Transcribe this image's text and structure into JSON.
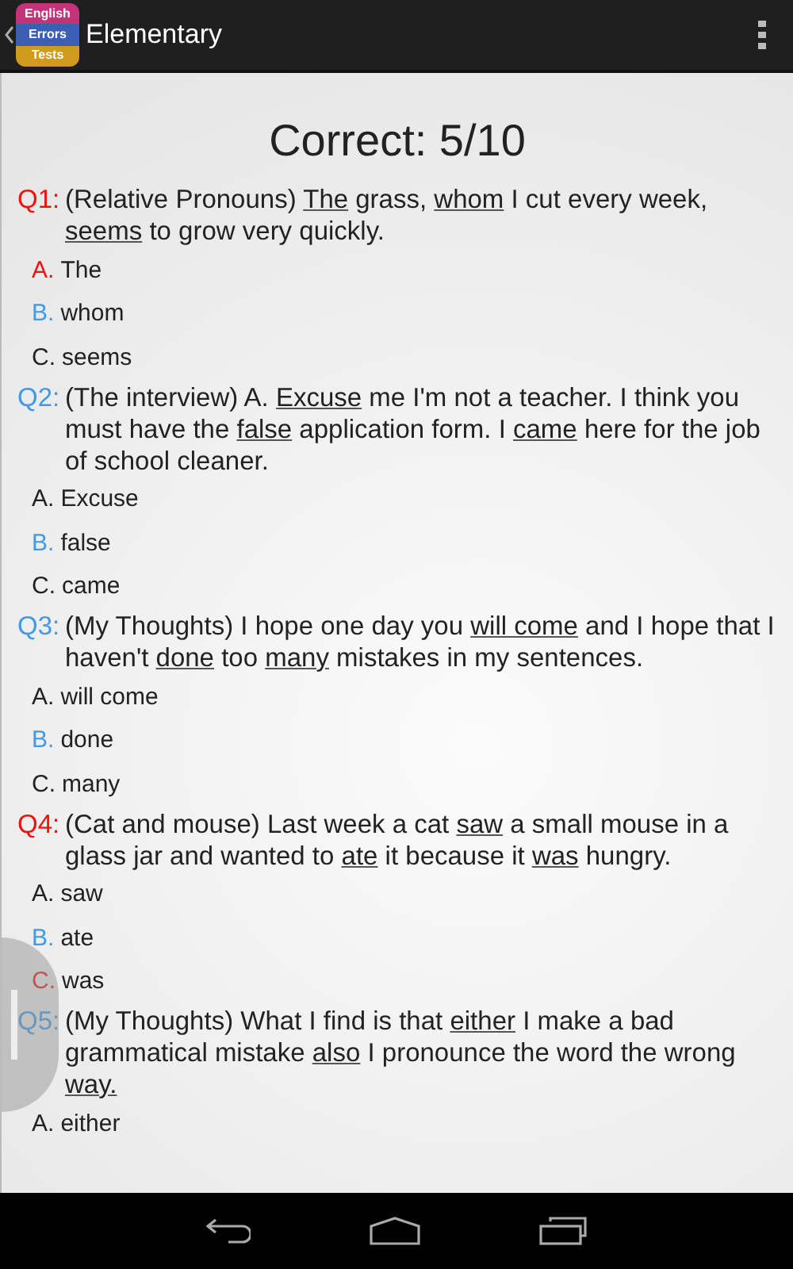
{
  "app_bar": {
    "logo_lines": [
      {
        "text": "English",
        "color": "#c2337a"
      },
      {
        "text": "Errors",
        "color": "#3b5fb5"
      },
      {
        "text": "Tests",
        "color": "#d19a1c"
      }
    ],
    "title": "Elementary"
  },
  "score": "Correct: 5/10",
  "questions": [
    {
      "label": "Q1:",
      "correct": false,
      "segments": [
        {
          "text": "(Relative Pronouns) ",
          "underlined": false
        },
        {
          "text": "The",
          "underlined": true
        },
        {
          "text": " grass, ",
          "underlined": false
        },
        {
          "text": "whom",
          "underlined": true
        },
        {
          "text": " I cut every week, ",
          "underlined": false
        },
        {
          "text": "seems",
          "underlined": true
        },
        {
          "text": " to grow very quickly.",
          "underlined": false
        }
      ],
      "options": [
        {
          "kind": "mistake",
          "letter": "A.",
          "text": "The"
        },
        {
          "kind": "answer",
          "letter": "B.",
          "text": "whom"
        },
        {
          "kind": "plain",
          "letter": "C.",
          "text": "seems"
        }
      ]
    },
    {
      "label": "Q2:",
      "correct": true,
      "segments": [
        {
          "text": "(The interview) A. ",
          "underlined": false
        },
        {
          "text": "Excuse",
          "underlined": true
        },
        {
          "text": " me I'm not a teacher. I think you must have the ",
          "underlined": false
        },
        {
          "text": "false",
          "underlined": true
        },
        {
          "text": " application form. I ",
          "underlined": false
        },
        {
          "text": "came",
          "underlined": true
        },
        {
          "text": " here for the job of school cleaner.",
          "underlined": false
        }
      ],
      "options": [
        {
          "kind": "plain",
          "letter": "A.",
          "text": "Excuse"
        },
        {
          "kind": "answer",
          "letter": "B.",
          "text": "false"
        },
        {
          "kind": "plain",
          "letter": "C.",
          "text": "came"
        }
      ]
    },
    {
      "label": "Q3:",
      "correct": true,
      "segments": [
        {
          "text": "(My Thoughts) I hope one day you ",
          "underlined": false
        },
        {
          "text": "will come",
          "underlined": true
        },
        {
          "text": " and I hope that I haven't ",
          "underlined": false
        },
        {
          "text": "done",
          "underlined": true
        },
        {
          "text": " too ",
          "underlined": false
        },
        {
          "text": "many",
          "underlined": true
        },
        {
          "text": " mistakes in my sentences.",
          "underlined": false
        }
      ],
      "options": [
        {
          "kind": "plain",
          "letter": "A.",
          "text": "will come"
        },
        {
          "kind": "answer",
          "letter": "B.",
          "text": "done"
        },
        {
          "kind": "plain",
          "letter": "C.",
          "text": "many"
        }
      ]
    },
    {
      "label": "Q4:",
      "correct": false,
      "segments": [
        {
          "text": "(Cat and mouse) Last week a cat ",
          "underlined": false
        },
        {
          "text": "saw",
          "underlined": true
        },
        {
          "text": " a small mouse in a glass jar and wanted to ",
          "underlined": false
        },
        {
          "text": "ate",
          "underlined": true
        },
        {
          "text": " it because it ",
          "underlined": false
        },
        {
          "text": "was",
          "underlined": true
        },
        {
          "text": " hungry.",
          "underlined": false
        }
      ],
      "options": [
        {
          "kind": "plain",
          "letter": "A.",
          "text": "saw"
        },
        {
          "kind": "answer",
          "letter": "B.",
          "text": "ate"
        },
        {
          "kind": "mistake",
          "letter": "C.",
          "text": "was"
        }
      ]
    },
    {
      "label": "Q5:",
      "correct": true,
      "segments": [
        {
          "text": "(My Thoughts) What I find is that ",
          "underlined": false
        },
        {
          "text": "either",
          "underlined": true
        },
        {
          "text": " I make a bad grammatical mistake ",
          "underlined": false
        },
        {
          "text": "also",
          "underlined": true
        },
        {
          "text": " I pronounce the word the wrong ",
          "underlined": false
        },
        {
          "text": "way.",
          "underlined": true
        }
      ],
      "options": [
        {
          "kind": "plain",
          "letter": "A.",
          "text": "either"
        }
      ]
    }
  ]
}
